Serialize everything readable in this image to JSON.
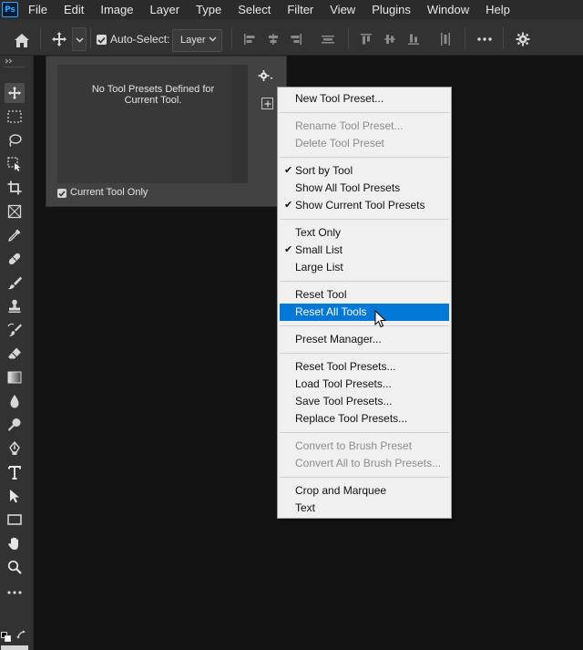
{
  "app": {
    "logo_text": "Ps"
  },
  "menubar": {
    "items": [
      "File",
      "Edit",
      "Image",
      "Layer",
      "Type",
      "Select",
      "Filter",
      "View",
      "Plugins",
      "Window",
      "Help"
    ]
  },
  "options_bar": {
    "auto_select_label": "Auto-Select:",
    "auto_select_checked": true,
    "layer_select_value": "Layer"
  },
  "preset_panel": {
    "empty_message": "No Tool Presets Defined for Current Tool.",
    "current_tool_only_label": "Current Tool Only",
    "current_tool_only_checked": true
  },
  "context_menu": {
    "groups": [
      [
        {
          "label": "New Tool Preset...",
          "enabled": true
        }
      ],
      [
        {
          "label": "Rename Tool Preset...",
          "enabled": false
        },
        {
          "label": "Delete Tool Preset",
          "enabled": false
        }
      ],
      [
        {
          "label": "Sort by Tool",
          "enabled": true,
          "checked": true
        },
        {
          "label": "Show All Tool Presets",
          "enabled": true
        },
        {
          "label": "Show Current Tool Presets",
          "enabled": true,
          "checked": true
        }
      ],
      [
        {
          "label": "Text Only",
          "enabled": true
        },
        {
          "label": "Small List",
          "enabled": true,
          "checked": true
        },
        {
          "label": "Large List",
          "enabled": true
        }
      ],
      [
        {
          "label": "Reset Tool",
          "enabled": true
        },
        {
          "label": "Reset All Tools",
          "enabled": true,
          "highlighted": true
        }
      ],
      [
        {
          "label": "Preset Manager...",
          "enabled": true
        }
      ],
      [
        {
          "label": "Reset Tool Presets...",
          "enabled": true
        },
        {
          "label": "Load Tool Presets...",
          "enabled": true
        },
        {
          "label": "Save Tool Presets...",
          "enabled": true
        },
        {
          "label": "Replace Tool Presets...",
          "enabled": true
        }
      ],
      [
        {
          "label": "Convert to Brush Preset",
          "enabled": false
        },
        {
          "label": "Convert All to Brush Presets...",
          "enabled": false
        }
      ],
      [
        {
          "label": "Crop and Marquee",
          "enabled": true
        },
        {
          "label": "Text",
          "enabled": true
        }
      ]
    ]
  },
  "toolbar": {
    "tools": [
      "move-tool",
      "rectangular-marquee-tool",
      "lasso-tool",
      "object-selection-tool",
      "crop-tool",
      "frame-tool",
      "eyedropper-tool",
      "spot-healing-brush-tool",
      "brush-tool",
      "clone-stamp-tool",
      "history-brush-tool",
      "eraser-tool",
      "gradient-tool",
      "blur-tool",
      "dodge-tool",
      "pen-tool",
      "type-tool",
      "path-selection-tool",
      "rectangle-tool",
      "hand-tool",
      "zoom-tool",
      "edit-toolbar"
    ],
    "active_tool": "move-tool"
  },
  "colors": {
    "menu_highlight": "#0078d7",
    "ps_logo_blue": "#31a8ff",
    "canvas_bg": "#131313"
  }
}
